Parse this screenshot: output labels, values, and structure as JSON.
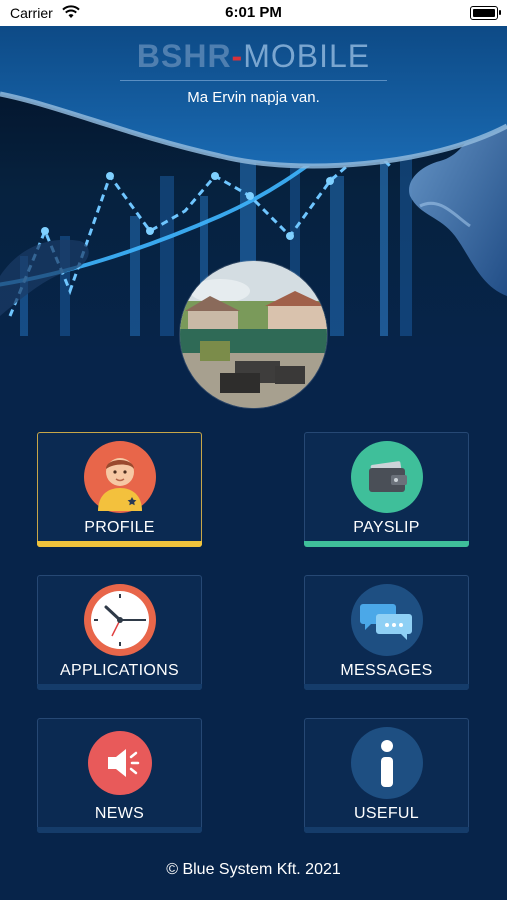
{
  "status": {
    "carrier": "Carrier",
    "time": "6:01 PM"
  },
  "header": {
    "logo_part1": "BS",
    "logo_part2": "HR",
    "logo_part3": "MOBILE",
    "greeting": "Ma Ervin napja van."
  },
  "menu": {
    "profile": "PROFILE",
    "payslip": "PAYSLIP",
    "applications": "APPLICATIONS",
    "messages": "MESSAGES",
    "news": "NEWS",
    "useful": "USEFUL"
  },
  "footer": {
    "copyright": "© Blue System Kft. 2021"
  },
  "colors": {
    "background": "#07244a",
    "profile_icon_bg": "#e8664a",
    "payslip_icon_bg": "#3fbf9a",
    "applications_icon_bg": "#e8664a",
    "messages_icon_bg": "#1e4f82",
    "news_icon_bg": "#e85a5a",
    "useful_icon_bg": "#1e4f82",
    "profile_accent": "#f0c33c",
    "payslip_accent": "#3fbf9a"
  },
  "icons": {
    "profile": "person-avatar-icon",
    "payslip": "wallet-icon",
    "applications": "clock-icon",
    "messages": "chat-bubbles-icon",
    "news": "speaker-icon",
    "useful": "info-icon"
  }
}
